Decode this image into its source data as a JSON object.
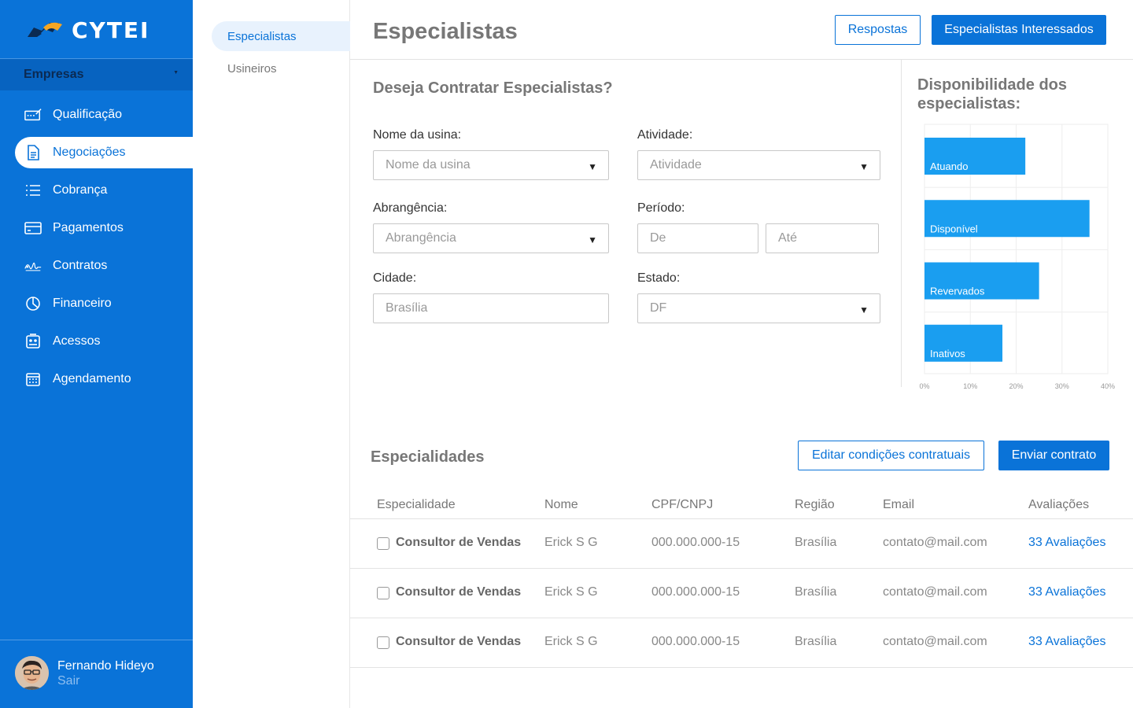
{
  "brand": {
    "logo_text": "CYTEI"
  },
  "sidebar": {
    "company_select": "Empresas",
    "items": [
      {
        "label": "Qualificação",
        "icon": "qualification-icon"
      },
      {
        "label": "Negociações",
        "icon": "document-icon"
      },
      {
        "label": "Cobrança",
        "icon": "list-icon"
      },
      {
        "label": "Pagamentos",
        "icon": "card-icon"
      },
      {
        "label": "Contratos",
        "icon": "signature-icon"
      },
      {
        "label": "Financeiro",
        "icon": "pie-chart-icon"
      },
      {
        "label": "Acessos",
        "icon": "access-icon"
      },
      {
        "label": "Agendamento",
        "icon": "calendar-icon"
      }
    ],
    "user": {
      "name": "Fernando Hideyo",
      "logout": "Sair"
    }
  },
  "subnav": {
    "items": [
      "Especialistas",
      "Usineiros"
    ]
  },
  "header": {
    "title": "Especialistas",
    "respostas_label": "Respostas",
    "interessados_label": "Especialistas Interessados"
  },
  "form": {
    "title": "Deseja Contratar Especialistas?",
    "usina_label": "Nome da usina:",
    "usina_placeholder": "Nome da usina",
    "atividade_label": "Atividade:",
    "atividade_placeholder": "Atividade",
    "abrangencia_label": "Abrangência:",
    "abrangencia_placeholder": "Abrangência",
    "periodo_label": "Período:",
    "periodo_de": "De",
    "periodo_ate": "Até",
    "cidade_label": "Cidade:",
    "cidade_value": "Brasília",
    "estado_label": "Estado:",
    "estado_value": "DF"
  },
  "chart_data": {
    "type": "bar",
    "orientation": "horizontal",
    "title": "Disponibilidade dos especialistas:",
    "categories": [
      "Atuando",
      "Disponível",
      "Revervados",
      "Inativos"
    ],
    "values": [
      22,
      36,
      25,
      17
    ],
    "x_ticks": [
      "0%",
      "10%",
      "20%",
      "30%",
      "40%"
    ],
    "xlim": [
      0,
      40
    ],
    "grid": true,
    "bar_color": "#1a9ef0"
  },
  "especialidades": {
    "title": "Especialidades",
    "edit_label": "Editar condições contratuais",
    "send_label": "Enviar contrato",
    "columns": [
      "Especialidade",
      "Nome",
      "CPF/CNPJ",
      "Região",
      "Email",
      "Avaliações"
    ],
    "rows": [
      {
        "especialidade": "Consultor de Vendas",
        "nome": "Erick S G",
        "cpf": "000.000.000-15",
        "regiao": "Brasília",
        "email": "contato@mail.com",
        "avaliacoes": "33 Avaliações"
      },
      {
        "especialidade": "Consultor de Vendas",
        "nome": "Erick S G",
        "cpf": "000.000.000-15",
        "regiao": "Brasília",
        "email": "contato@mail.com",
        "avaliacoes": "33 Avaliações"
      },
      {
        "especialidade": "Consultor de Vendas",
        "nome": "Erick S G",
        "cpf": "000.000.000-15",
        "regiao": "Brasília",
        "email": "contato@mail.com",
        "avaliacoes": "33 Avaliações"
      }
    ]
  },
  "colors": {
    "primary": "#0a73d8",
    "sidebar_dark": "#0763c0",
    "logo_orange": "#f5a623",
    "logo_navy": "#0b2a52"
  }
}
